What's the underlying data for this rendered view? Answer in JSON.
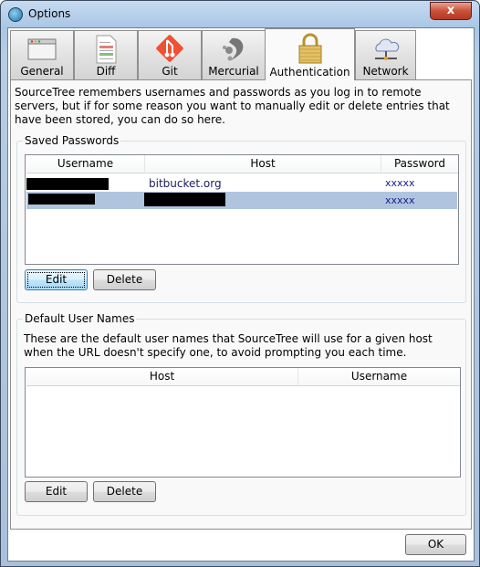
{
  "window": {
    "title": "Options",
    "close_label": "x"
  },
  "tabs": [
    {
      "label": "General",
      "icon": "window-icon"
    },
    {
      "label": "Diff",
      "icon": "diff-document-icon"
    },
    {
      "label": "Git",
      "icon": "git-logo-icon"
    },
    {
      "label": "Mercurial",
      "icon": "mercurial-logo-icon"
    },
    {
      "label": "Authentication",
      "icon": "padlock-icon",
      "active": true
    },
    {
      "label": "Network",
      "icon": "network-cloud-icon"
    }
  ],
  "description": "SourceTree remembers usernames and passwords as you log in to remote servers, but if for some reason you want to manually edit or delete entries that have been stored, you can do so here.",
  "saved_passwords": {
    "title": "Saved Passwords",
    "columns": [
      "Username",
      "Host",
      "Password"
    ],
    "rows": [
      {
        "username": "",
        "host": "bitbucket.org",
        "password": "xxxxx",
        "selected": false
      },
      {
        "username": "",
        "host": "",
        "password": "xxxxx",
        "selected": true
      }
    ],
    "edit_label": "Edit",
    "delete_label": "Delete"
  },
  "default_user_names": {
    "title": "Default User Names",
    "description": "These are the default user names that SourceTree will use for a given host when the URL doesn't specify one, to avoid prompting you each time.",
    "columns": [
      "Host",
      "Username"
    ],
    "edit_label": "Edit",
    "delete_label": "Delete"
  },
  "footer": {
    "ok_label": "OK"
  },
  "colors": {
    "selected_row": "#b0c4de",
    "password_text": "#1c1c8c"
  }
}
